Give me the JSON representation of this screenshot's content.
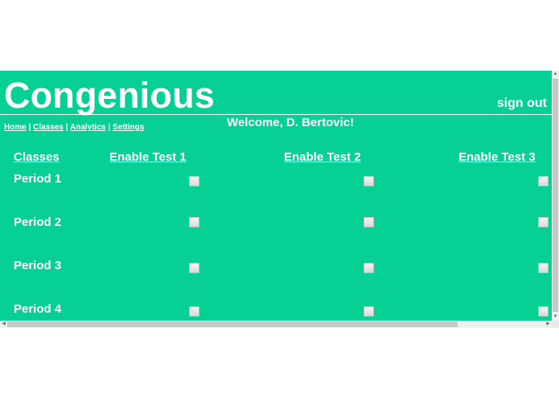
{
  "header": {
    "brand": "Congenious",
    "signout": "sign out",
    "welcome": "Welcome, D. Bertovic!"
  },
  "nav": {
    "items": [
      "Home",
      "Classes",
      "Analytics",
      "Settings"
    ],
    "separator": "|"
  },
  "table": {
    "headers": [
      "Classes",
      "Enable Test 1",
      "Enable Test 2",
      "Enable Test 3"
    ],
    "rows": [
      {
        "label": "Period 1",
        "checks": [
          false,
          false,
          false
        ]
      },
      {
        "label": "Period 2",
        "checks": [
          false,
          false,
          false
        ]
      },
      {
        "label": "Period 3",
        "checks": [
          false,
          false,
          false
        ]
      },
      {
        "label": "Period 4",
        "checks": [
          false,
          false,
          false
        ]
      }
    ]
  },
  "scrollbar": {
    "up_arrow": "▲",
    "down_arrow": "▼",
    "left_arrow": "◀",
    "right_arrow": "▶"
  },
  "colors": {
    "background": "#06d094",
    "text": "#ffffff",
    "checkbox_border": "#bdbdbd"
  }
}
